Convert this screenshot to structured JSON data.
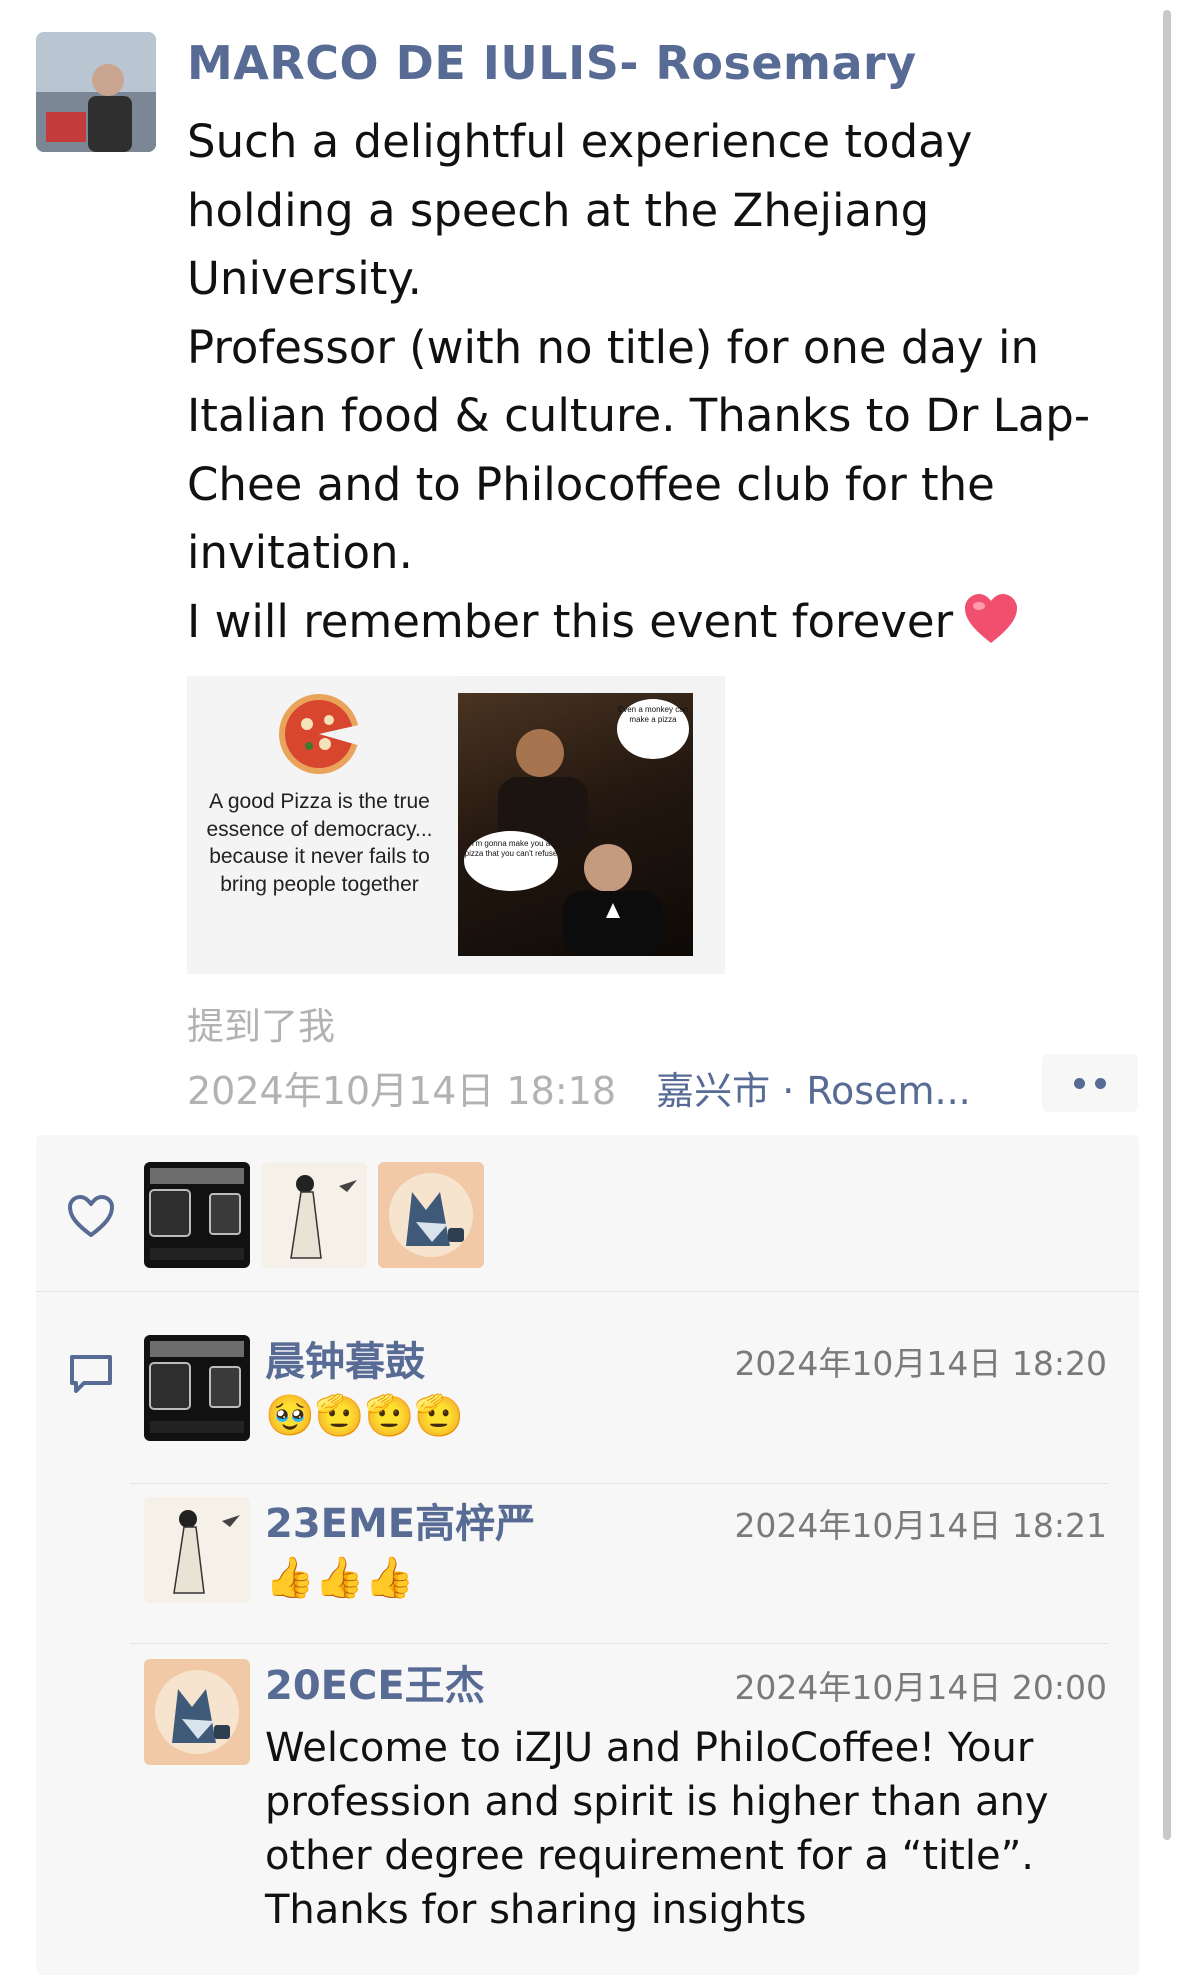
{
  "post": {
    "author": "MARCO DE IULIS- Rosemary",
    "text_lines": [
      "Such a delightful experience today holding a speech at the Zhejiang University.",
      "Professor (with no title) for one day in Italian food & culture.  Thanks to Dr Lap-Chee and to Philocoffee club for the invitation.",
      "I will remember this event forever"
    ],
    "trailing_emoji": "red-heart-emoji",
    "images": {
      "pizza_quote": "A good Pizza is the true essence of democracy... because it never fails to bring people together",
      "bubble_1": "Even a monkey can make a pizza",
      "bubble_2": "I'm gonna make you a pizza that you can't refuse"
    },
    "mention": "提到了我",
    "timestamp": "2024年10月14日 18:18",
    "location": "嘉兴市 · Rosem..."
  },
  "likes": {
    "icon": "heart-outline-icon",
    "avatars": [
      "train-window-avatar",
      "ink-painting-avatar",
      "wolf-coffee-avatar"
    ]
  },
  "comments": [
    {
      "name": "晨钟暮鼓",
      "time": "2024年10月14日 18:20",
      "body": "🥹🫡🫡🫡",
      "avatar": "train-window-avatar"
    },
    {
      "name": "23EME高梓严",
      "time": "2024年10月14日 18:21",
      "body": "👍👍👍",
      "avatar": "ink-painting-avatar"
    },
    {
      "name": "20ECE王杰",
      "time": "2024年10月14日 20:00",
      "body": "Welcome to iZJU and PhiloCoffee!   Your profession and spirit is higher than any other degree requirement for a “title”. Thanks for sharing insights",
      "avatar": "wolf-coffee-avatar"
    }
  ],
  "colors": {
    "link": "#576b95",
    "meta": "#b2b2b2",
    "panel": "#f7f7f7"
  }
}
